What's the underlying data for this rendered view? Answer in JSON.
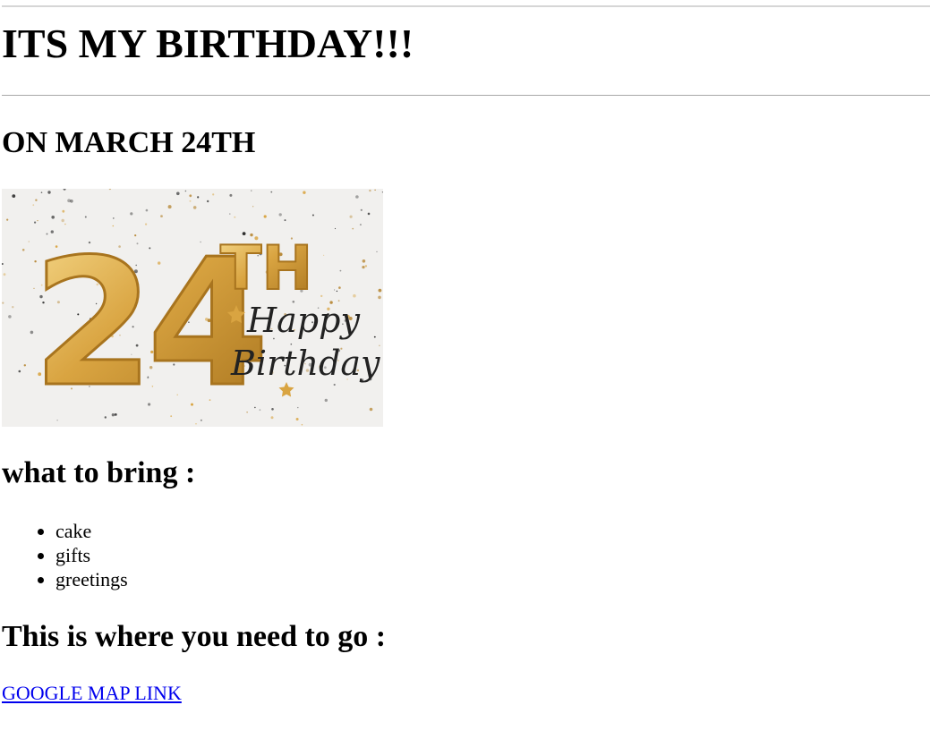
{
  "header": {
    "title": "ITS MY BIRTHDAY!!!",
    "date": "ON MARCH 24TH"
  },
  "banner": {
    "number": "24",
    "suffix": "TH",
    "script_line1": "Happy",
    "script_line2": "Birthday",
    "colors": {
      "gold": "#d9a441",
      "gold_dark": "#a8741e",
      "background": "#f1f0ee",
      "script": "#222222"
    }
  },
  "bring": {
    "heading": "what to bring :",
    "items": [
      "cake",
      "gifts",
      "greetings"
    ]
  },
  "directions": {
    "heading": "This is where you need to go :",
    "link_label": "GOOGLE MAP LINK",
    "link_color": "#0000ee"
  }
}
